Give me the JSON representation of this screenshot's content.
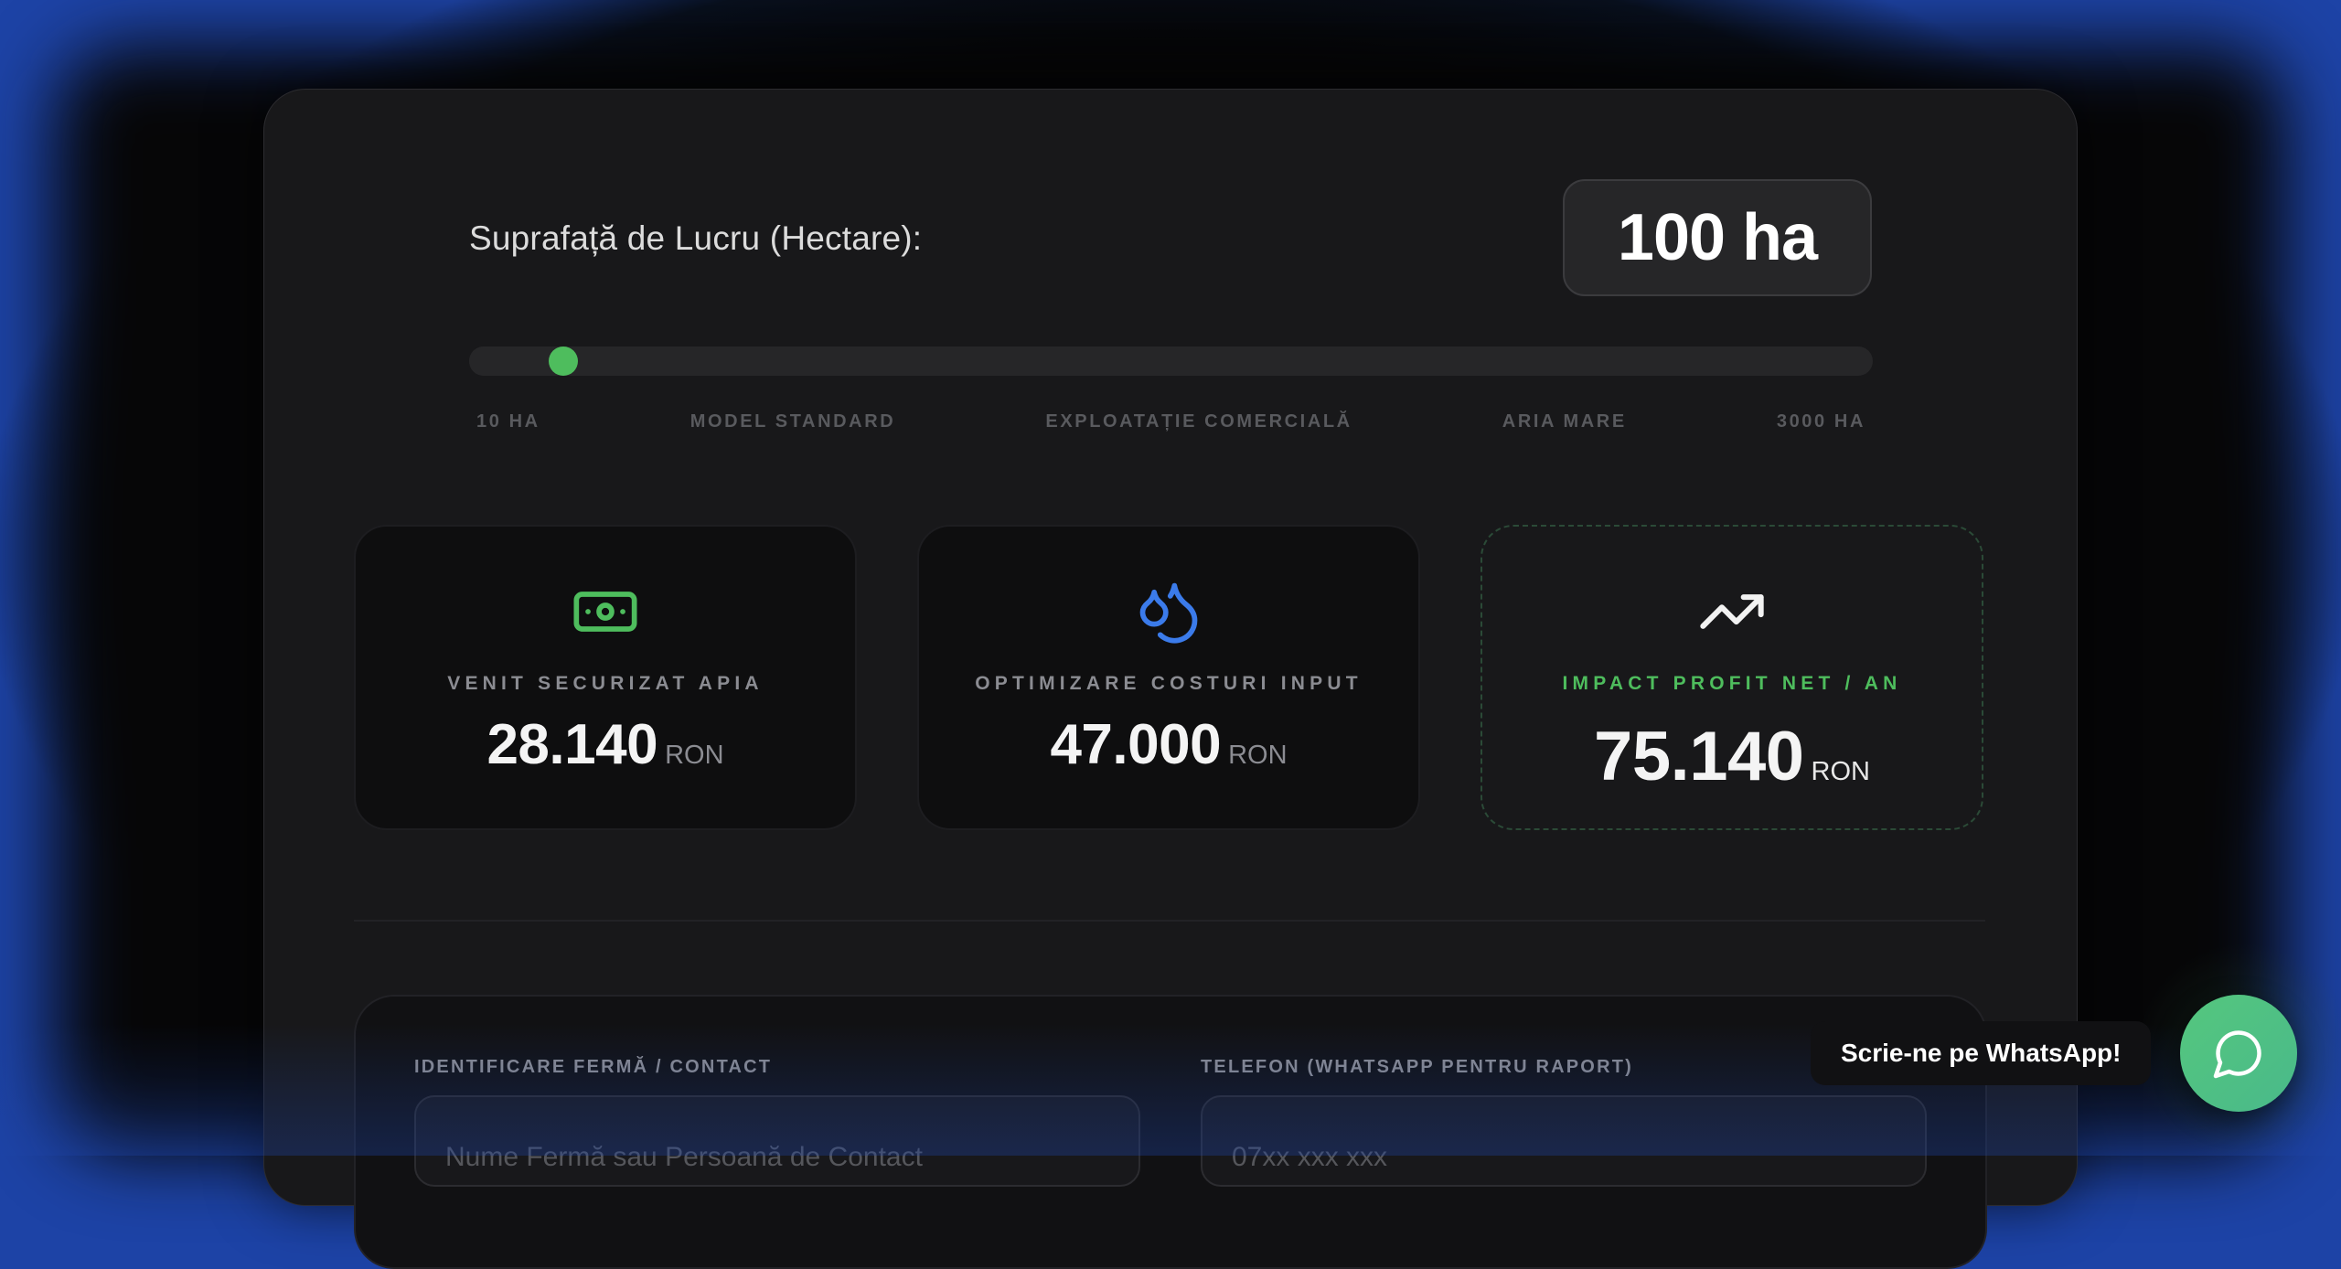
{
  "calculator": {
    "area_label": "Suprafață de Lucru (Hectare):",
    "area_value": "100 ha",
    "slider": {
      "min": 10,
      "max": 3000,
      "value": 100,
      "accent_color": "#4ebd5d",
      "marks": [
        "10 HA",
        "MODEL STANDARD",
        "EXPLOATAȚIE COMERCIALĂ",
        "ARIA MARE",
        "3000 HA"
      ]
    },
    "stats": [
      {
        "icon": "banknote-icon",
        "icon_color": "#4ebd5d",
        "label": "VENIT SECURIZAT APIA",
        "value": "28.140",
        "unit": "RON"
      },
      {
        "icon": "droplets-icon",
        "icon_color": "#3b7bea",
        "label": "OPTIMIZARE COSTURI INPUT",
        "value": "47.000",
        "unit": "RON"
      },
      {
        "icon": "trending-up-icon",
        "icon_color": "#f2f2f2",
        "label": "IMPACT PROFIT NET / AN",
        "value": "75.140",
        "unit": "RON"
      }
    ]
  },
  "form": {
    "contact_label": "IDENTIFICARE FERMĂ / CONTACT",
    "contact_placeholder": "Nume Fermă sau Persoană de Contact",
    "phone_label": "TELEFON (WHATSAPP PENTRU RAPORT)",
    "phone_placeholder": "07xx xxx xxx"
  },
  "whatsapp": {
    "bubble_text": "Scrie-ne pe WhatsApp!",
    "icon": "chat-bubble-icon",
    "button_color": "#4fbf83"
  }
}
